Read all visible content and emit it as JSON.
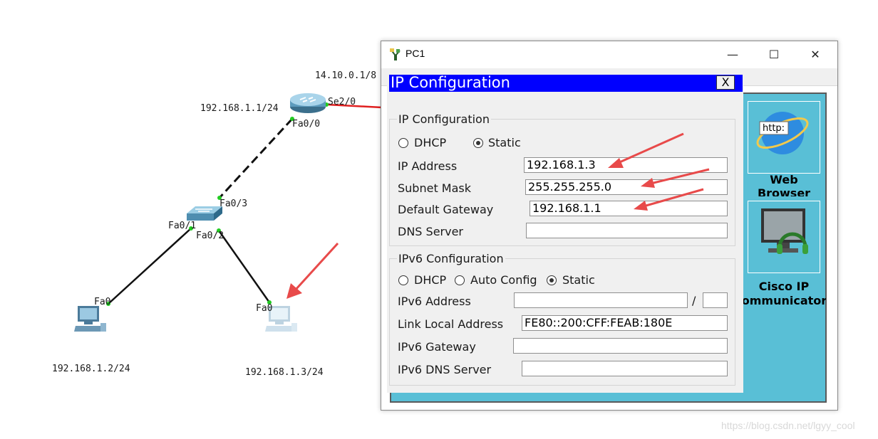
{
  "topology": {
    "labels": {
      "serial_net": "14.10.0.1/8",
      "lan_gw": "192.168.1.1/24",
      "se": "Se2/0",
      "fa00": "Fa0/0",
      "fa03": "Fa0/3",
      "fa01": "Fa0/1",
      "fa02": "Fa0/2",
      "pc0_port": "Fa0",
      "pc1_port": "Fa0",
      "pc0_ip": "192.168.1.2/24",
      "pc1_ip": "192.168.1.3/24"
    },
    "colors": {
      "serial_link": "#e02020",
      "link": "#111111",
      "port_dot": "#22cc22",
      "annotation_arrow": "#e84a4a"
    }
  },
  "window": {
    "title": "PC1",
    "controls": {
      "minimize": "—",
      "maximize": "☐",
      "close": "✕"
    }
  },
  "desktop": {
    "apps": [
      {
        "label_line1": "Web",
        "label_line2": "Browser",
        "icon": "web-browser-icon",
        "badge": "http:"
      },
      {
        "label_line1": "Cisco IP",
        "label_line2": "Communicator",
        "icon": "ip-communicator-icon"
      }
    ]
  },
  "ip_config": {
    "header": "IP Configuration",
    "close": "X",
    "ipv4": {
      "group_title": "IP Configuration",
      "dhcp_label": "DHCP",
      "static_label": "Static",
      "mode": "Static",
      "ip_address_label": "IP Address",
      "ip_address": "192.168.1.3",
      "subnet_label": "Subnet Mask",
      "subnet": "255.255.255.0",
      "gateway_label": "Default Gateway",
      "gateway": "192.168.1.1",
      "dns_label": "DNS Server",
      "dns": ""
    },
    "ipv6": {
      "group_title": "IPv6 Configuration",
      "dhcp_label": "DHCP",
      "auto_label": "Auto Config",
      "static_label": "Static",
      "mode": "Static",
      "address_label": "IPv6 Address",
      "address": "",
      "slash": "/",
      "prefix": "",
      "link_local_label": "Link Local Address",
      "link_local": "FE80::200:CFF:FEAB:180E",
      "gateway_label": "IPv6 Gateway",
      "gateway": "",
      "dns_label": "IPv6 DNS Server",
      "dns": ""
    }
  },
  "watermark": "https://blog.csdn.net/lgyy_cool"
}
